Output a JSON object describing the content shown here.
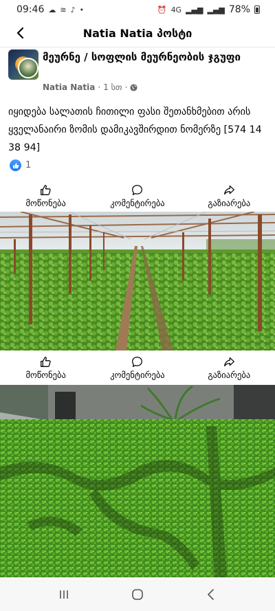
{
  "status_bar": {
    "time": "09:46",
    "battery": "78%",
    "network": "4G"
  },
  "header": {
    "title": "Natia Natia პოსტი"
  },
  "post": {
    "group_name": "მეურნე / სოფლის მეურნეობის ჯგუფი",
    "author": "Natia Natia",
    "time_ago": "1 სთ",
    "separator": "·",
    "text": "იყიდება სალათის ჩითილი ფასი შეთანხმებით არის ყველანაირი ზომის დამიკავშირდით ნომერზე [574 14 38 94]",
    "reaction_count": "1"
  },
  "actions": {
    "like": "მოწონება",
    "comment": "კომენტირება",
    "share": "გაზიარება"
  },
  "icons": {
    "back": "back-arrow-icon",
    "like": "thumbs-up-icon",
    "comment": "comment-bubble-icon",
    "share": "share-arrow-icon",
    "globe": "globe-icon",
    "recents": "recent-apps-icon",
    "home": "home-icon",
    "nav_back": "nav-back-icon"
  },
  "colors": {
    "accent": "#1877f2",
    "text_primary": "#050505",
    "text_secondary": "#65676b",
    "divider": "#e4e6eb"
  }
}
